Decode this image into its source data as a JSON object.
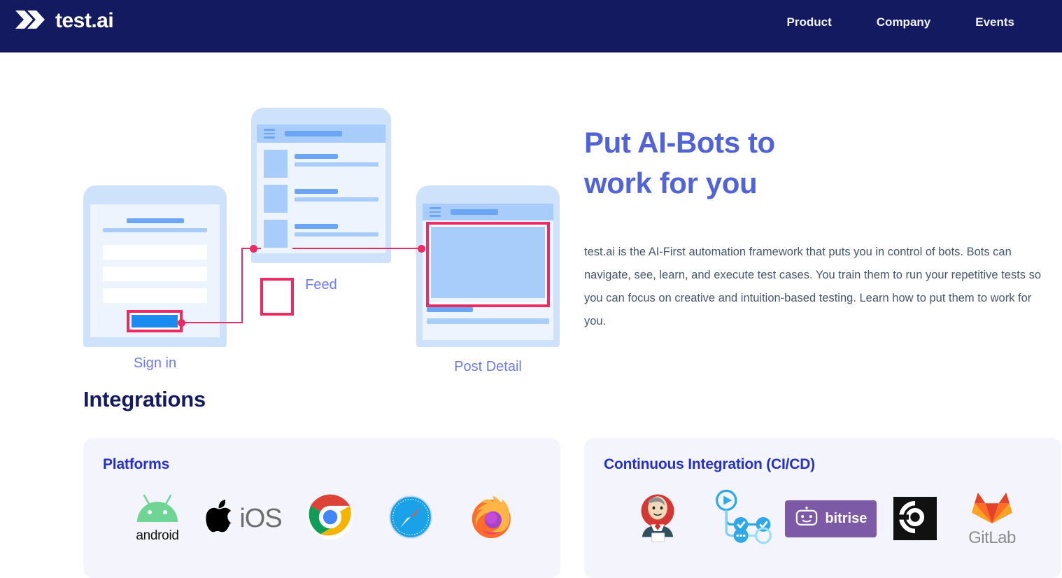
{
  "header": {
    "brand_name": "test.ai",
    "brand_icon": "double-chevron-icon",
    "nav": [
      {
        "label": "Product"
      },
      {
        "label": "Company"
      },
      {
        "label": "Events"
      }
    ]
  },
  "hero": {
    "title_line1": "Put AI-Bots to",
    "title_line2": "work for you",
    "paragraph": "test.ai is the AI-First automation framework that puts you in control of bots. Bots can navigate, see, learn, and execute test cases. You train them to run your repetitive tests so you can focus on creative and intuition-based testing. Learn how to put them to work for you.",
    "title_color": "#5263d8",
    "illustration": {
      "screens": [
        {
          "label": "Sign in"
        },
        {
          "label": "Feed"
        },
        {
          "label": "Post Detail"
        }
      ],
      "highlight_color": "#ee2a62",
      "button_color": "#1a8cf0"
    }
  },
  "integrations": {
    "title": "Integrations",
    "cards": [
      {
        "title": "Platforms",
        "title_color": "#2430c9",
        "logos": [
          {
            "name": "android-logo",
            "label": "android"
          },
          {
            "name": "ios-logo",
            "label": "iOS"
          },
          {
            "name": "chrome-logo",
            "label": "Chrome"
          },
          {
            "name": "safari-logo",
            "label": "Safari"
          },
          {
            "name": "firefox-logo",
            "label": "Firefox"
          }
        ]
      },
      {
        "title": "Continuous Integration (CI/CD)",
        "title_color": "#2430c9",
        "logos": [
          {
            "name": "jenkins-logo",
            "label": "Jenkins"
          },
          {
            "name": "azure-pipelines-logo",
            "label": "Azure Pipelines"
          },
          {
            "name": "bitrise-logo",
            "label": "bitrise"
          },
          {
            "name": "circleci-logo",
            "label": "CircleCI"
          },
          {
            "name": "gitlab-logo",
            "label": "GitLab"
          }
        ]
      }
    ]
  },
  "theme": {
    "header_bg": "#141a60",
    "card_bg": "#f4f4fd",
    "page_bg": "#ffffff"
  }
}
